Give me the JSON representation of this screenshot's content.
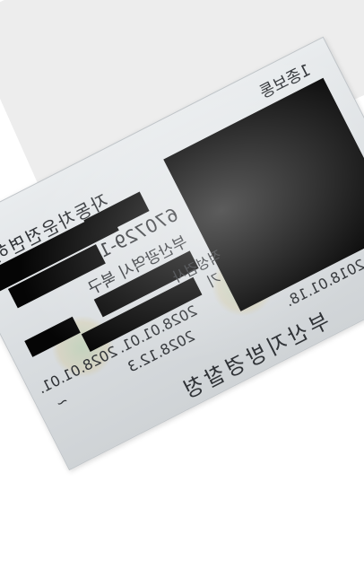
{
  "card": {
    "card_type_label": "1종보통",
    "title": "자동차운전면허증",
    "id_number_partial": "670729-1",
    "address_line1": "부산광역시 북구",
    "address_line2_partial": "적성검사",
    "address_line3_partial": "기",
    "date_aptitude_1": "2028.01.01.",
    "date_aptitude_2": "2028.12.3",
    "date_sub_1": "2028.01.01.",
    "date_sub_2": "~",
    "issue_date": "2018.01.18.",
    "issuer": "부산지방경찰청"
  }
}
